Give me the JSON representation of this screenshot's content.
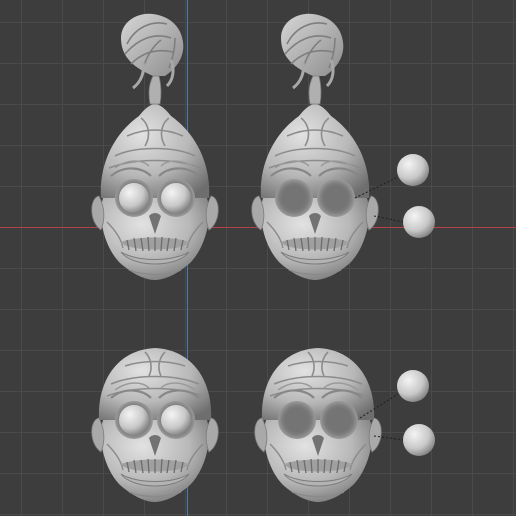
{
  "viewport": {
    "view": "front-orthographic",
    "colors": {
      "background": "#3d3d3d",
      "grid": "#4a4a4a",
      "x_axis": "#b5414b",
      "z_axis": "#4a79b3",
      "clay": "#bdbdbd",
      "clay_dark": "#8a8a8a"
    }
  },
  "scene": {
    "objects": [
      {
        "name": "head-with-hair-tuft",
        "position": "top-left",
        "eyes": "embedded"
      },
      {
        "name": "head-with-hair-tuft-exploded-eyes",
        "position": "top-right",
        "eyes": "separate"
      },
      {
        "name": "head-bald",
        "position": "bottom-left",
        "eyes": "embedded"
      },
      {
        "name": "head-bald-exploded-eyes",
        "position": "bottom-right",
        "eyes": "separate"
      }
    ]
  }
}
